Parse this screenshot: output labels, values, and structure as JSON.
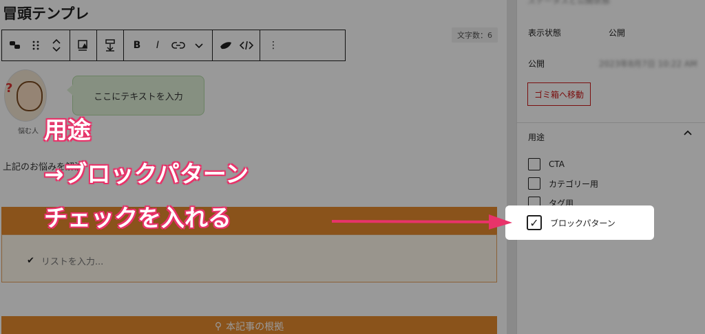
{
  "editor": {
    "title": "冒頭テンプレ",
    "word_count": "文字数：6",
    "toolbar": {
      "bold": "B",
      "italic": "I",
      "more": "⋮"
    },
    "avatar_name": "悩む人",
    "bubble_text": "ここにテキストを入力",
    "body_text": "上記のお悩みを解決",
    "list_placeholder": "リストを入力...",
    "section_heading": "本記事の根拠"
  },
  "sidebar": {
    "top_label": "ステータスと公開状態",
    "visibility_label": "表示状態",
    "visibility_value": "公開",
    "publish_label": "公開",
    "publish_value": "2023年8月7日 10:22 AM",
    "trash_button": "ゴミ箱へ移動",
    "panel_title": "用途",
    "checkboxes": [
      {
        "label": "CTA",
        "checked": false
      },
      {
        "label": "カテゴリー用",
        "checked": false
      },
      {
        "label": "タグ用",
        "checked": false
      },
      {
        "label": "ブロックパターン",
        "checked": true
      }
    ]
  },
  "annotation": {
    "line1": "用途",
    "line2": "→ブロックパターン",
    "line3": "チェックを入れる"
  },
  "colors": {
    "accent_orange": "#e68a2e",
    "annotation_pink": "#e8336a",
    "trash_red": "#cc1818"
  }
}
